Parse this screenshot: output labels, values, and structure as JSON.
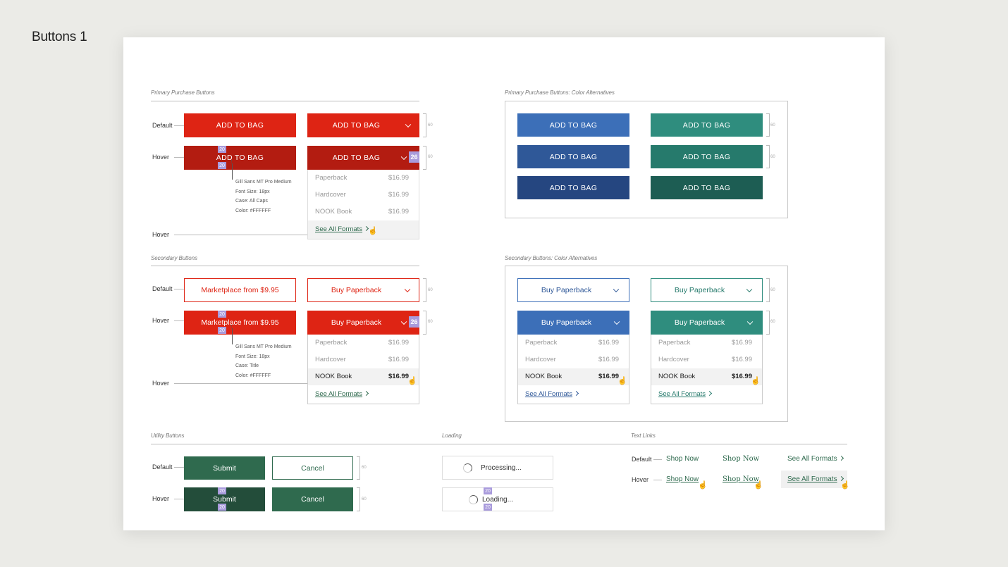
{
  "page_title": "Buttons 1",
  "states": {
    "default": "Default",
    "hover": "Hover"
  },
  "dimension_60": "60",
  "pad_20": "20",
  "pad_26": "26",
  "primary": {
    "label": "Primary Purchase Buttons",
    "add_to_bag": "ADD TO BAG",
    "menu": [
      {
        "name": "Paperback",
        "price": "$16.99"
      },
      {
        "name": "Hardcover",
        "price": "$16.99"
      },
      {
        "name": "NOOK Book",
        "price": "$16.99"
      }
    ],
    "see_all": "See All Formats",
    "spec": [
      "Gill Sans MT Pro Medium",
      "Font Size: 18px",
      "Case: All Caps",
      "Color: #FFFFFF"
    ]
  },
  "primary_alt": {
    "label": "Primary Purchase Buttons: Color Alternatives",
    "add_to_bag": "ADD TO BAG"
  },
  "secondary": {
    "label": "Secondary Buttons",
    "marketplace": "Marketplace from $9.95",
    "buy_paperback": "Buy Paperback",
    "spec": [
      "Gill Sans MT Pro Medium",
      "Font Size: 18px",
      "Case: Title",
      "Color: #FFFFFF"
    ],
    "see_all": "See All Formats"
  },
  "secondary_alt": {
    "label": "Secondary Buttons: Color Alternatives",
    "buy_paperback": "Buy Paperback",
    "see_all": "See All Formats"
  },
  "utility": {
    "label": "Utility Buttons",
    "submit": "Submit",
    "cancel": "Cancel"
  },
  "loading": {
    "label": "Loading",
    "processing": "Processing...",
    "loading": "Loading..."
  },
  "text_links": {
    "label": "Text Links",
    "shop_now": "Shop Now",
    "see_all": "See All Formats"
  },
  "colors": {
    "red": "#de2414",
    "red_hover": "#b31c11",
    "blue": [
      "#3c6fb8",
      "#2f5898",
      "#254680"
    ],
    "teal": [
      "#2f8d7e",
      "#267a6c",
      "#1d5d53"
    ],
    "green": "#2f6a4e",
    "green_hover": "#234d3a",
    "padding_marker": "#a99bdc"
  },
  "icons": [
    "chevron-down-icon",
    "chevron-right-icon",
    "pointer-cursor-icon",
    "spinner-icon",
    "arrow-up-icon"
  ]
}
